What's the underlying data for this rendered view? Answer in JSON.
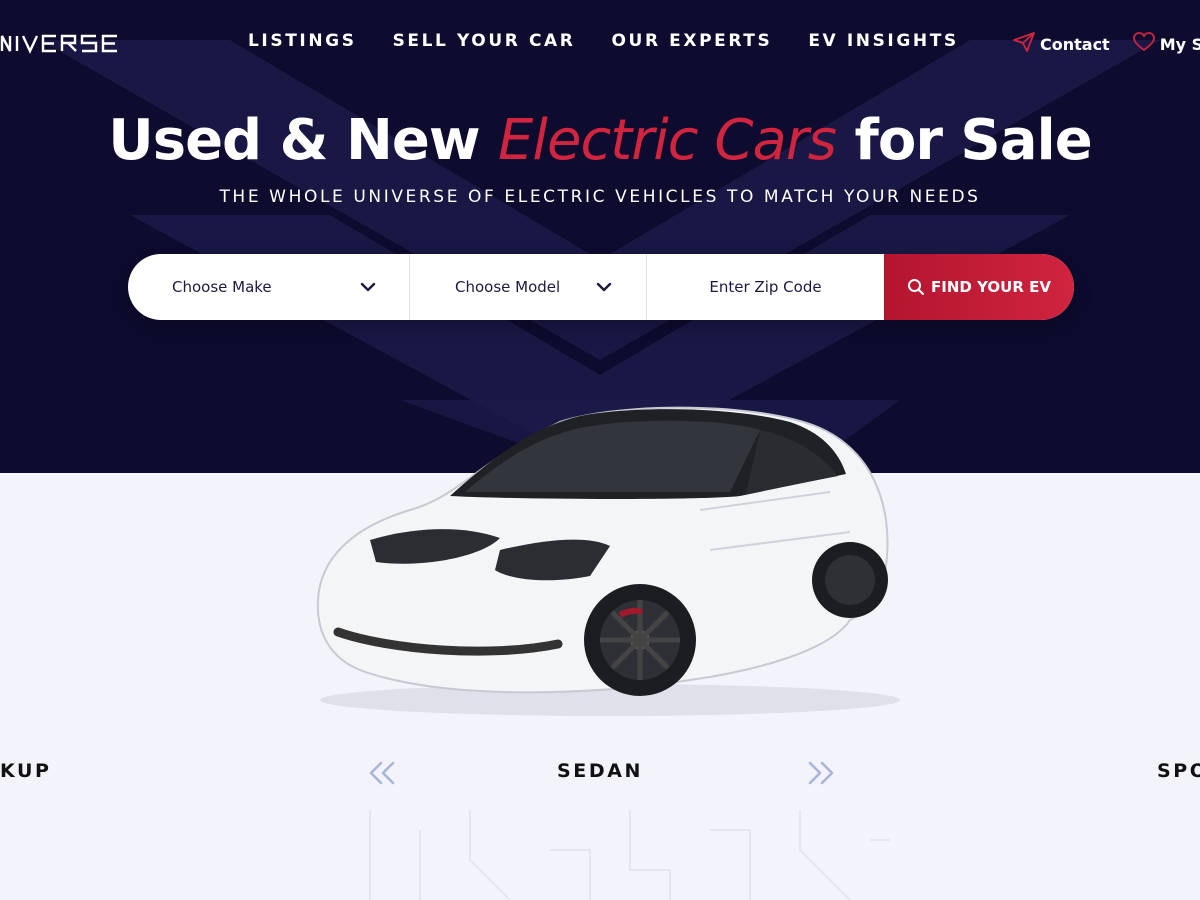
{
  "brand": {
    "logo_text": "NIVERSE"
  },
  "nav": {
    "items": [
      "LISTINGS",
      "SELL YOUR CAR",
      "OUR EXPERTS",
      "EV INSIGHTS"
    ]
  },
  "utility": {
    "contact_label": "Contact",
    "saved_label": "My Se"
  },
  "hero": {
    "title_part1": "Used & New ",
    "title_accent": "Electric Cars",
    "title_part2": " for Sale",
    "subtitle": "THE WHOLE UNIVERSE OF ELECTRIC VEHICLES TO MATCH YOUR NEEDS"
  },
  "search": {
    "make_label": "Choose Make",
    "model_label": "Choose Model",
    "zip_placeholder": "Enter Zip Code",
    "zip_value": "",
    "button_label": "FIND YOUR EV"
  },
  "body_types": {
    "previous": "KUP",
    "current": "SEDAN",
    "next": "SPO"
  },
  "colors": {
    "hero_bg": "#0d0b2e",
    "accent": "#d0243f",
    "page_bg": "#f3f4fb",
    "text_dark": "#1d1a40"
  }
}
